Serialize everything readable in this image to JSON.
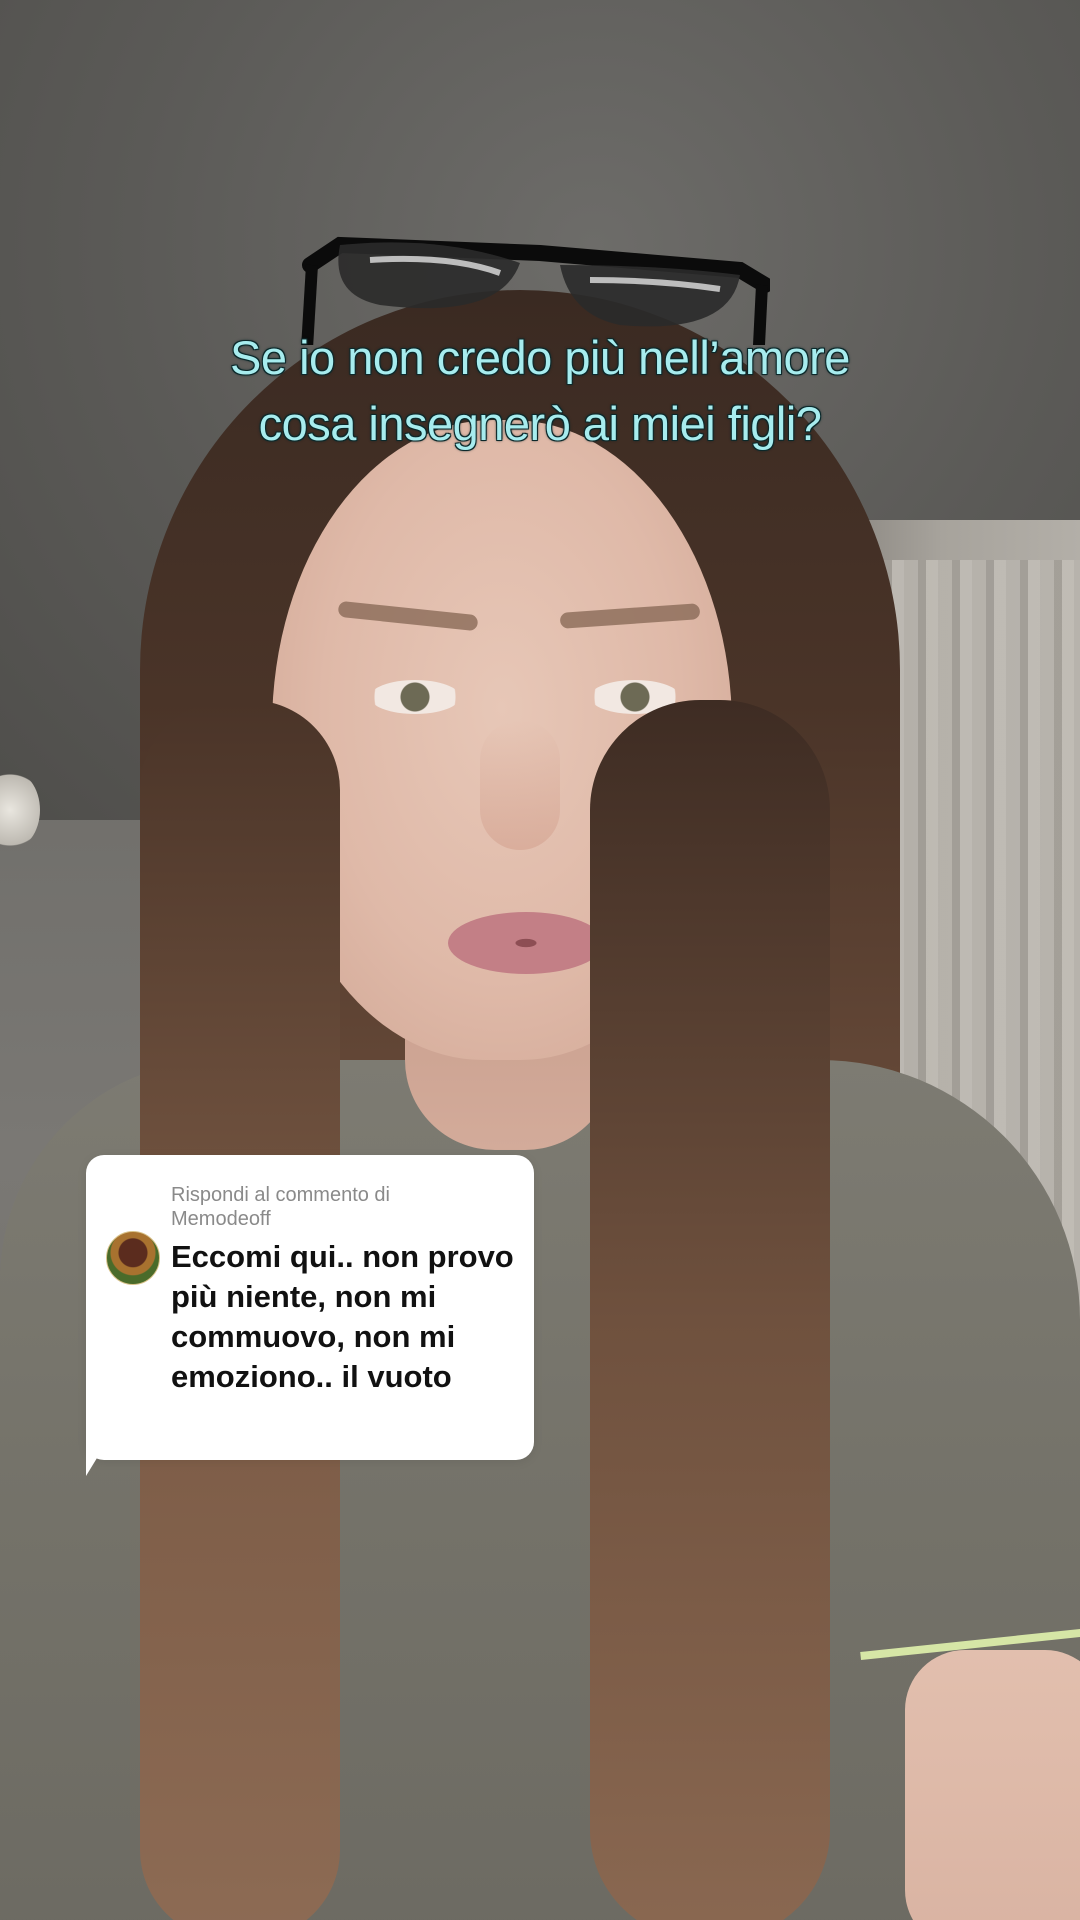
{
  "video": {
    "caption_line1": "Se io non credo più nell’amore",
    "caption_line2": "cosa insegnerò ai miei figli?"
  },
  "reply_comment": {
    "header": "Rispondi al commento di Memodeoff",
    "text": "Eccomi qui.. non provo più niente, non mi commuovo, non mi emoziono.. il vuoto"
  },
  "colors": {
    "caption_text": "#a7ecee",
    "caption_outline": "#0d2a2c",
    "bubble_bg": "#ffffff"
  }
}
